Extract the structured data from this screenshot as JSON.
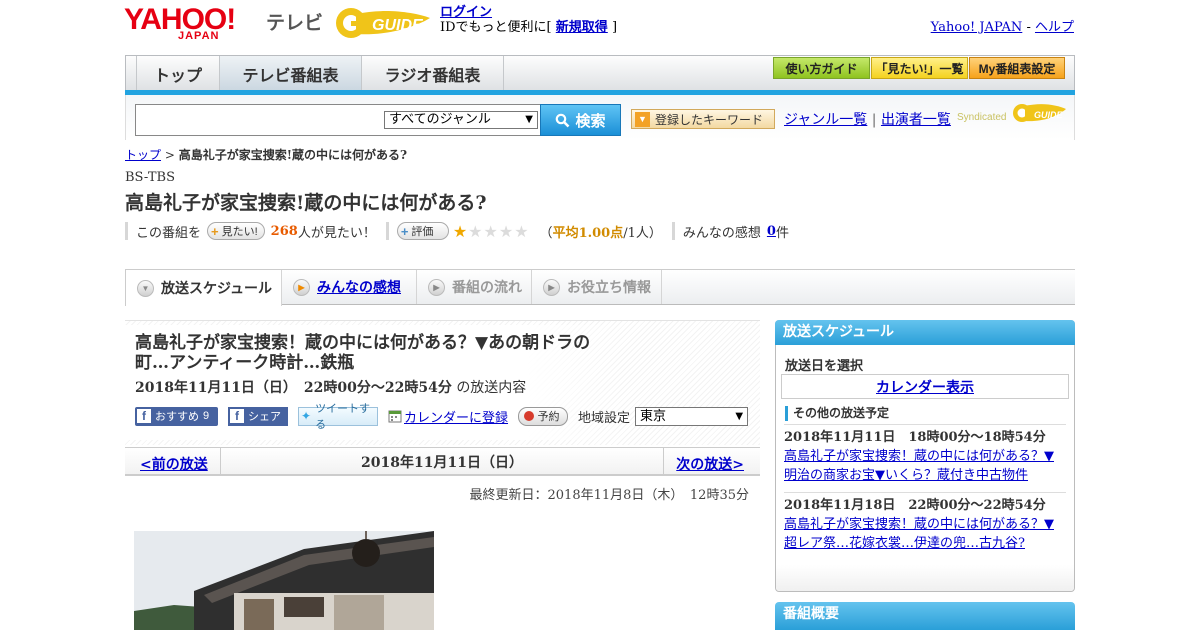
{
  "header": {
    "logo_yahoo": "YAHOO!",
    "logo_japan": "JAPAN",
    "logo_tv": "テレビ",
    "logo_gguide": "GUIDE",
    "login_link": "ログイン",
    "login_text_pre": "IDでもっと便利に[",
    "register_link": "新規取得",
    "login_text_post": "]",
    "yahoo_japan_link": "Yahoo! JAPAN",
    "separator": "-",
    "help_link": "ヘルプ"
  },
  "nav": {
    "tabs": [
      "トップ",
      "テレビ番組表",
      "ラジオ番組表"
    ],
    "tool_buttons": [
      "使い方ガイド",
      "「見たい!」一覧",
      "My番組表設定"
    ]
  },
  "search": {
    "genre_selected": "すべてのジャンル",
    "search_button": "検索",
    "keyword_button": "登録したキーワード",
    "genre_list_link": "ジャンル一覧",
    "divider": "|",
    "performer_list_link": "出演者一覧",
    "syndicated": "Syndicated"
  },
  "program": {
    "breadcrumb_top": "トップ",
    "breadcrumb_sep": ">",
    "breadcrumb_current": "高島礼子が家宝捜索!蔵の中には何がある?",
    "channel": "BS-TBS",
    "title": "高島礼子が家宝捜索!蔵の中には何がある?",
    "want_prefix": "この番組を",
    "want_button": "見たい!",
    "want_count": "268",
    "want_suffix": "人が見たい！",
    "rate_button": "評価",
    "rating": 1,
    "rating_max": 5,
    "avg_open": "（",
    "avg_label": "平均1.00点",
    "avg_people": "/1人）",
    "comments_label": "みんなの感想",
    "comments_count": "0",
    "comments_unit": "件"
  },
  "tabs": {
    "schedule": "放送スケジュール",
    "impressions": "みんなの感想",
    "flow": "番組の流れ",
    "info": "お役立ち情報"
  },
  "episode": {
    "title": "高島礼子が家宝捜索！蔵の中には何がある？▼あの朝ドラの町…アンティーク時計…鉄瓶",
    "datetime": "2018年11月11日（日）　22時00分～22時54分",
    "datetime_suffix": "の放送内容",
    "fb_recommend": "おすすめ",
    "fb_recommend_count": "9",
    "fb_share": "シェア",
    "tweet": "ツイートする",
    "calendar_add": "カレンダーに登録",
    "reserve": "予約",
    "region_label": "地域設定",
    "region_value": "東京"
  },
  "pager": {
    "prev": "<前の放送",
    "date": "2018年11月11日（日）",
    "next": "次の放送>"
  },
  "updated": "最終更新日：2018年11月8日（木）　12時35分",
  "sidebar": {
    "schedule_title": "放送スケジュール",
    "select_date": "放送日を選択",
    "calendar_link": "カレンダー表示",
    "other_label": "その他の放送予定",
    "entries": [
      {
        "time": "2018年11月11日　18時00分～18時54分",
        "line1": "高島礼子が家宝捜索！蔵の中には何がある？▼",
        "line2": "明治の商家お宝▼いくら？蔵付き中古物件"
      },
      {
        "time": "2018年11月18日　22時00分～22時54分",
        "line1": "高島礼子が家宝捜索！蔵の中には何がある？▼",
        "line2": "超レア祭…花嫁衣裳…伊達の兜…古九谷?"
      }
    ],
    "overview_title": "番組概要"
  },
  "colors": {
    "accent_blue": "#22a3e0",
    "link": "#0000cc",
    "yahoo_red": "#e60012",
    "star": "#f0a800",
    "facebook": "#4662a0"
  }
}
